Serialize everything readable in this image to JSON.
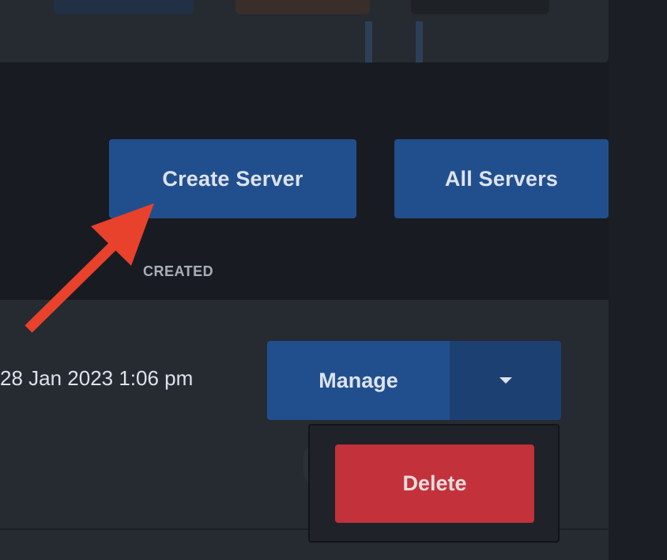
{
  "actions": {
    "create_server_label": "Create Server",
    "all_servers_label": "All Servers"
  },
  "table": {
    "created_header": "CREATED"
  },
  "server_row": {
    "created": "28 Jan 2023 1:06 pm",
    "manage_label": "Manage",
    "menu_toggle_icon": "caret-down-icon"
  },
  "dropdown_menu": {
    "delete_label": "Delete"
  },
  "annotation": {
    "arrow_color": "#e8412c"
  },
  "colors": {
    "page_background": "#181c22",
    "panel": "#262a31",
    "primary": "#214f8e",
    "danger": "#c3313a"
  }
}
